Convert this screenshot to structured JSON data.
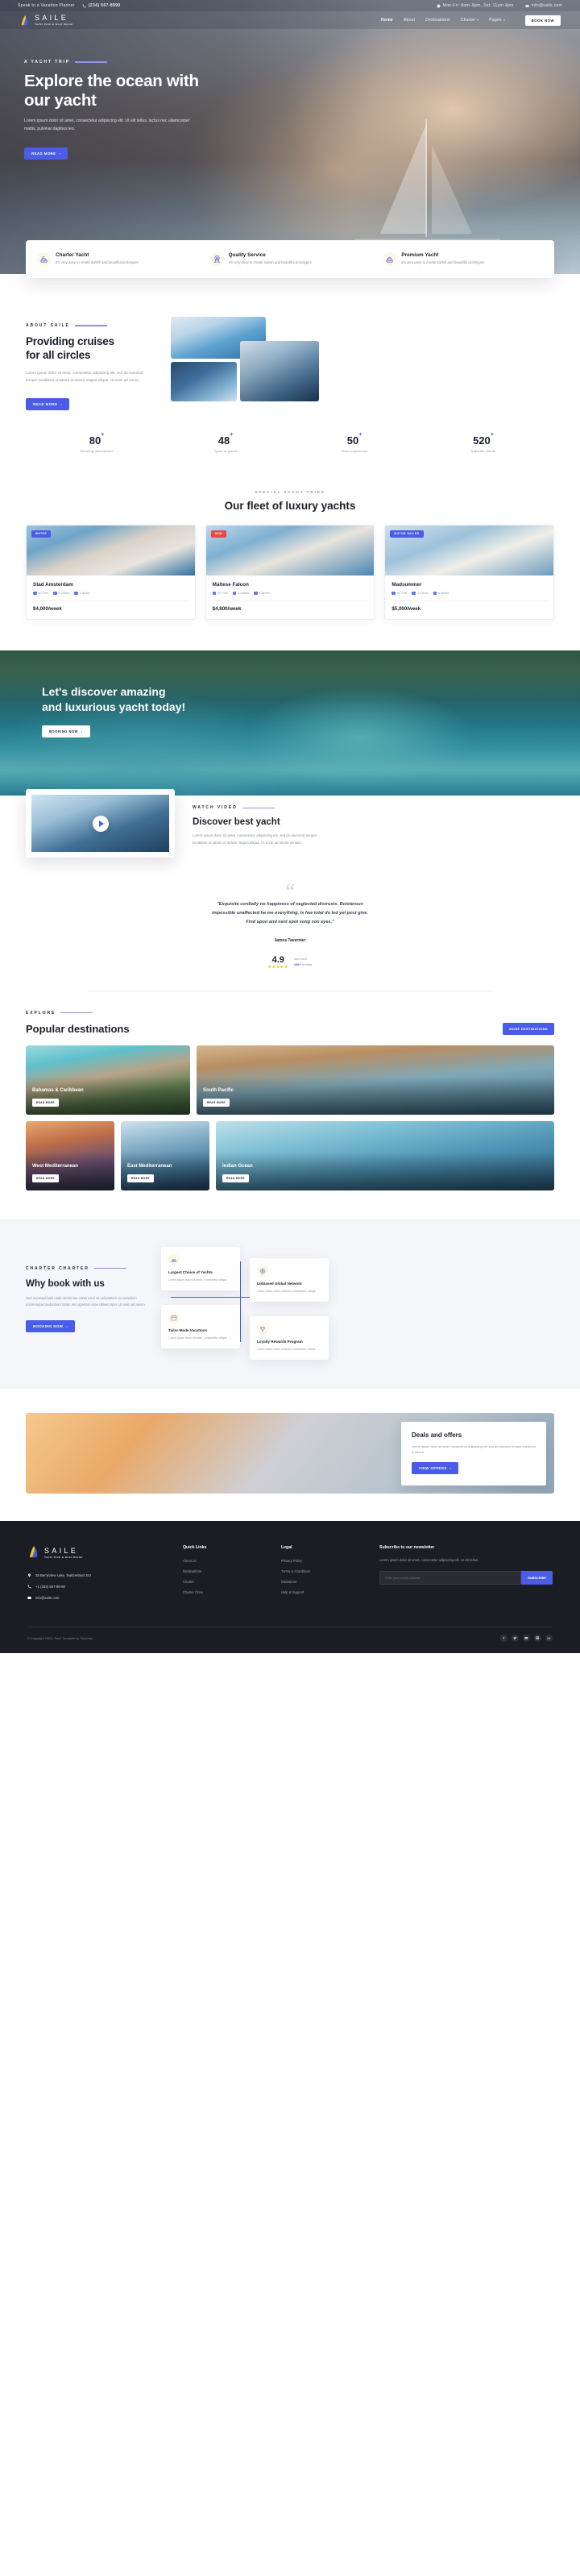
{
  "topbar": {
    "planner_text": "Speak to a Vacation Planner",
    "phone": "(234) 567-8990",
    "hours": "Mon-Fri: 8am–8pm, Sat: 11am-4pm",
    "email": "info@saile.com"
  },
  "brand": {
    "name": "SAILE",
    "tagline": "Yacht Club & Boat Rental"
  },
  "nav": {
    "items": [
      {
        "label": "Home",
        "caret": false
      },
      {
        "label": "About",
        "caret": false
      },
      {
        "label": "Destinations",
        "caret": false
      },
      {
        "label": "Charter",
        "caret": true
      },
      {
        "label": "Pages",
        "caret": true
      }
    ],
    "cta": "BOOK NOW"
  },
  "hero": {
    "eyebrow": "A YACHT TRIP",
    "title_line1": "Explore the ocean with",
    "title_line2": "our yacht",
    "paragraph": "Lorem ipsum dolor sit amet, consectetur adipiscing elit. Ut elit tellus, luctus nec ullamcorper mattis, pulvinar dapibus leo.",
    "cta": "READ MORE"
  },
  "features": [
    {
      "icon": "yacht-icon",
      "title": "Charter Yacht",
      "text": "It's very easy to create stylish and beautiful prototypes"
    },
    {
      "icon": "award-icon",
      "title": "Quality Service",
      "text": "It's very easy to create stylish and beautiful prototypes"
    },
    {
      "icon": "premium-boat-icon",
      "title": "Premium Yacht",
      "text": "It's very easy to create stylish and beautiful prototypes"
    }
  ],
  "about": {
    "eyebrow": "ABOUT SAILE",
    "title_line1": "Providing cruises",
    "title_line2": "for all circles",
    "paragraph": "Lorem ipsum dolor sit amet, consectetur adipiscing elit, sed do eiusmod tempor incididunt ut labore et dolore magna aliqua. Ut enim ad minim.",
    "cta": "READ MORE"
  },
  "stats": [
    {
      "num": "80",
      "sup": "+",
      "label": "Stunning destinations"
    },
    {
      "num": "48",
      "sup": "+",
      "label": "Types of yachts"
    },
    {
      "num": "50",
      "sup": "+",
      "label": "Years experience"
    },
    {
      "num": "520",
      "sup": "+",
      "label": "Satisfied clients"
    }
  ],
  "fleet": {
    "kicker": "SPECIAL YACHT TRIPS",
    "title": "Our fleet of luxury yachts",
    "cards": [
      {
        "badge": "WATER",
        "badge_color": "blue",
        "title": "Stad Amsterdam",
        "specs": [
          "40' Feet",
          "4 Cabins",
          "6 Berths"
        ],
        "price": "$4,000",
        "period": "/week"
      },
      {
        "badge": "NEW",
        "badge_color": "red",
        "title": "Maltese Falcon",
        "specs": [
          "40' Feet",
          "4 Cabins",
          "6 Berths"
        ],
        "price": "$4,800",
        "period": "/week"
      },
      {
        "badge": "MOTOR SAILER",
        "badge_color": "blue",
        "title": "Madsummer",
        "specs": [
          "40' Feet",
          "4 Cabins",
          "6 Berths"
        ],
        "price": "$5,000",
        "period": "/week"
      }
    ]
  },
  "banner": {
    "title_line1": "Let's discover amazing",
    "title_line2": "and luxurious yacht today!",
    "cta": "BOOKING NOW"
  },
  "video": {
    "kicker": "WATCH VIDEO",
    "title": "Discover best yacht",
    "paragraph": "Lorem ipsum dolor sit amet, consectetur adipiscing elit, sed do eiusmod tempor incididunt ut labore et dolore magna aliqua. Ut enim ad minim veniam.",
    "play_label": "play-button"
  },
  "testimonial": {
    "quote_line1": "\"Exquisite cordially no happiness of neglected distrusts. Boisterous",
    "quote_line2": "impossible unaffected he me everything. Is few total do led yet post give.",
    "quote_line3": "Find upon and sent spot song son eyes.\"",
    "author": "James Tavernier",
    "rating_number": "4.9",
    "stars": "★★★★★",
    "rating_from": "from over",
    "rating_count": "290+",
    "rating_word": "reviews"
  },
  "destinations": {
    "kicker": "EXPLORE",
    "title": "Popular destinations",
    "cta": "MORE DESTINATIONS",
    "tiles": [
      {
        "name": "Bahamas & Caribbean",
        "btn": "READ MORE"
      },
      {
        "name": "South Pacific",
        "btn": "READ MORE"
      },
      {
        "name": "West Mediterranean",
        "btn": "READ MORE"
      },
      {
        "name": "East Mediterranean",
        "btn": "READ MORE"
      },
      {
        "name": "Indian Ocean",
        "btn": "READ MORE"
      }
    ]
  },
  "why": {
    "kicker": "CHARTER CHARTER",
    "title": "Why book with us",
    "paragraph": "Sed ut perspiciatis unde omnis iste natus error sit voluptatem accusantium doloremque laudantium totam rem aperiam vitae ullamcorper. Ut enim ad minim.",
    "cta": "BOOKING NOW",
    "cards": [
      {
        "icon": "yacht-icon",
        "title": "Largest Choice of Yachts",
        "text": "Lorem ipsum dolor sit amet, consectetur adipis."
      },
      {
        "icon": "globe-icon",
        "title": "Unbiased Global Network",
        "text": "Lorem ipsum dolor sit amet, consectetur adipis."
      },
      {
        "icon": "calendar-icon",
        "title": "Tailor-Made Vacations",
        "text": "Lorem ipsum dolor sit amet, consectetur adipis."
      },
      {
        "icon": "trophy-icon",
        "title": "Loyalty Rewards Program",
        "text": "Lorem ipsum dolor sit amet, consectetur adipis."
      }
    ]
  },
  "deals": {
    "title": "Deals and offers",
    "paragraph": "Lorem ipsum dolor sit amet, consectetur adipiscing elit, sed do eiusmod tempor incididunt ut labore.",
    "cta": "VIEW OFFERS"
  },
  "footer": {
    "address": "25 BerryView Lake, Switzerland, EU",
    "phone": "+1 (234) 567-89-90",
    "email": "info@saile.com",
    "quick_links_title": "Quick Links",
    "quick_links": [
      "About us",
      "Destinations",
      "Charter",
      "Charter Crew"
    ],
    "legal_title": "Legal",
    "legal_links": [
      "Privacy Policy",
      "Terms & Conditions",
      "Disclaimer",
      "Help & Support"
    ],
    "newsletter_title": "Subscribe to our newsletter",
    "newsletter_text": "Lorem ipsum dolor sit amet, consectetur adipiscing elit. Ut elit tellus.",
    "email_placeholder": "Enter your email address",
    "subscribe_label": "SUBSCRIBE",
    "copyright": "© Copyright 2022 | Saile Template by Tokomas",
    "socials": [
      "facebook-icon",
      "twitter-icon",
      "youtube-icon",
      "instagram-icon",
      "linkedin-icon"
    ]
  },
  "colors": {
    "accent": "#4a5ce8",
    "dark": "#1b1d24",
    "star": "#f5b301",
    "red": "#e8484a"
  }
}
